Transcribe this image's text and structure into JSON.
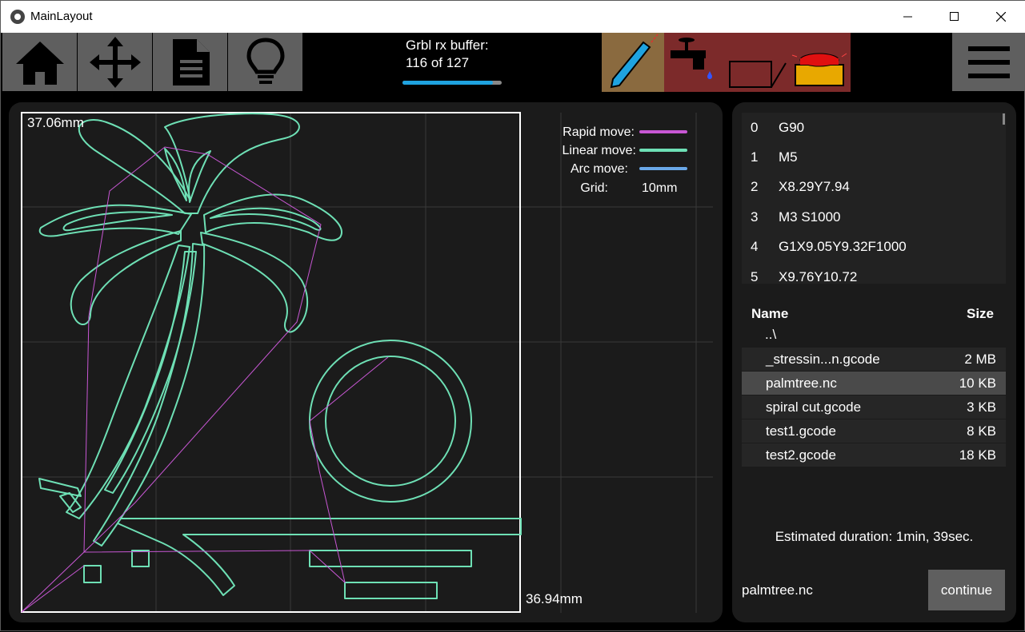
{
  "window": {
    "title": "MainLayout",
    "minimize_glyph": "—",
    "maximize_glyph": "☐",
    "close_glyph": "✕"
  },
  "toolbar": {
    "buttons": [
      {
        "icon": "home-icon"
      },
      {
        "icon": "move-icon"
      },
      {
        "icon": "file-icon"
      },
      {
        "icon": "bulb-icon"
      }
    ],
    "buffer_label": "Grbl rx buffer:",
    "buffer_value": "116 of 127",
    "buffer_fraction": 0.913,
    "modes": [
      "pen-icon",
      "coolant-icon",
      "laser-icon",
      "estop-icon"
    ]
  },
  "plot": {
    "y_extent_label": "37.06mm",
    "x_extent_label": "36.94mm",
    "legend": {
      "rapid_label": "Rapid move:",
      "linear_label": "Linear move:",
      "arc_label": "Arc move:",
      "grid_label": "Grid:",
      "grid_value": "10mm"
    },
    "colors": {
      "rapid": "#c857d4",
      "linear": "#6ee0b5",
      "arc": "#6aa8e8",
      "grid": "#3a3a3a",
      "bounds": "#ffffff"
    }
  },
  "gcode": {
    "lines": [
      {
        "index": "0",
        "code": "G90"
      },
      {
        "index": "1",
        "code": "M5"
      },
      {
        "index": "2",
        "code": "X8.29Y7.94"
      },
      {
        "index": "3",
        "code": "M3 S1000"
      },
      {
        "index": "4",
        "code": "G1X9.05Y9.32F1000"
      },
      {
        "index": "5",
        "code": "X9.76Y10.72"
      }
    ]
  },
  "files": {
    "header_name": "Name",
    "header_size": "Size",
    "parent_dir": "..\\",
    "rows": [
      {
        "name": "_stressin...n.gcode",
        "size": "2 MB"
      },
      {
        "name": "palmtree.nc",
        "size": "10 KB"
      },
      {
        "name": "spiral cut.gcode",
        "size": "3 KB"
      },
      {
        "name": "test1.gcode",
        "size": "8 KB"
      },
      {
        "name": "test2.gcode",
        "size": "18 KB"
      }
    ],
    "selected": "palmtree.nc"
  },
  "status": {
    "estimate": "Estimated duration: 1min, 39sec.",
    "current_file": "palmtree.nc",
    "continue_label": "continue"
  }
}
